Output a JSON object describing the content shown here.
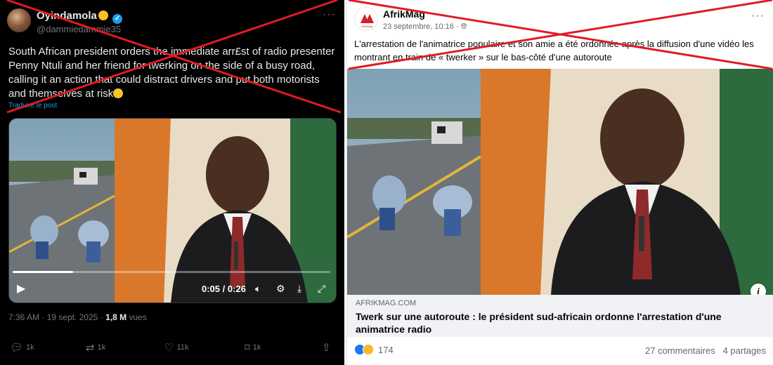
{
  "tweet": {
    "display_name": "Oyindamola",
    "handle": "@dammiedammie35",
    "more_label": "···",
    "text": "South African president orders the immediate arr£st of radio presenter Penny Ntuli and her friend for twerking on the side of a busy road, calling it an action that could distract drivers and put both motorists and themselves at risk",
    "translate_label": "Traduire le post",
    "video": {
      "time_display": "0:05 / 0:26",
      "progress": 0.19
    },
    "meta": {
      "time": "7:36 AM",
      "date": "19 sept. 2025",
      "views": "1,8 M",
      "views_label": "vues",
      "separator": "·"
    },
    "actions": {
      "replies": "1k",
      "reposts": "1k",
      "likes": "11k",
      "bookmarks": "1k"
    },
    "icons": [
      "verified-badge-icon",
      "more-icon",
      "play-icon",
      "volume-icon",
      "settings-icon",
      "minimize-icon",
      "fullscreen-icon",
      "reply-icon",
      "repost-icon",
      "like-icon",
      "bookmark-icon",
      "share-icon"
    ]
  },
  "fb": {
    "page_name": "AfrikMag",
    "logo_text": "AfrikMag",
    "date": "23 septembre, 10:16 ·",
    "more_label": "···",
    "text": "L'arrestation de l'animatrice populaire et son amie a été ordonnée après la diffusion d'une vidéo les montrant en train de « twerker » sur le bas-côté d'une autoroute",
    "link_domain": "AFRIKMAG.COM",
    "link_headline": "Twerk sur une autoroute : le président sud-africain ordonne l'arrestation d'une animatrice radio",
    "reaction_count": "174",
    "comments": "27 commentaires",
    "shares": "4 partages",
    "info_label": "i",
    "icons": [
      "globe-icon",
      "more-icon",
      "info-icon",
      "like-reaction-icon",
      "haha-reaction-icon"
    ]
  },
  "colors": {
    "x_background": "#000000",
    "x_link": "#1d9bf0",
    "fb_link_box": "#f0f2f5",
    "cross_red": "#e01b24"
  }
}
